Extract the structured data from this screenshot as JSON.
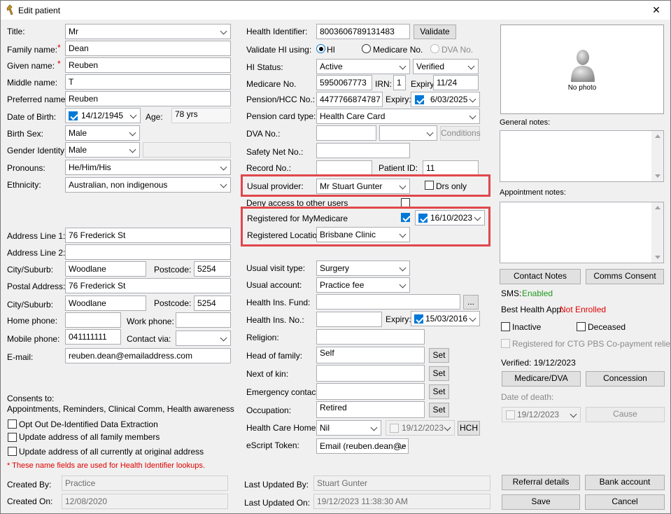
{
  "window": {
    "title": "Edit patient",
    "close_glyph": "✕"
  },
  "left": {
    "title_label": "Title:",
    "title_value": "Mr",
    "family_label": "Family name:",
    "family_value": "Dean",
    "given_label": "Given name:",
    "given_value": "Reuben",
    "middle_label": "Middle name:",
    "middle_value": "T",
    "preferred_label": "Preferred name:",
    "preferred_value": "Reuben",
    "dob_label": "Date of Birth:",
    "dob_value": "14/12/1945",
    "age_label": "Age:",
    "age_value": "78 yrs",
    "sex_label": "Birth Sex:",
    "sex_value": "Male",
    "gender_label": "Gender Identity:",
    "gender_value": "Male",
    "gender_extra": "",
    "pronouns_label": "Pronouns:",
    "pronouns_value": "He/Him/His",
    "ethnicity_label": "Ethnicity:",
    "ethnicity_value": "Australian, non indigenous",
    "addr1_label": "Address Line 1:",
    "addr1_value": "76 Frederick St",
    "addr2_label": "Address Line 2:",
    "addr2_value": "",
    "city_label": "City/Suburb:",
    "city_value": "Woodlane",
    "postcode_label": "Postcode:",
    "postcode_value": "5254",
    "postal_label": "Postal Address:",
    "postal_value": "76 Frederick St",
    "city2_label": "City/Suburb:",
    "city2_value": "Woodlane",
    "postcode2_label": "Postcode:",
    "postcode2_value": "5254",
    "home_label": "Home phone:",
    "home_value": "",
    "work_label": "Work phone:",
    "work_value": "",
    "mobile_label": "Mobile phone:",
    "mobile_value": "041111111",
    "contactvia_label": "Contact via:",
    "contactvia_value": "",
    "email_label": "E-mail:",
    "email_value": "reuben.dean@emailaddress.com",
    "consents_label": "Consents to:",
    "consents_value": "Appointments, Reminders, Clinical Comm, Health awareness",
    "optout_label": "Opt Out De-Identified Data Extraction",
    "update_family_label": "Update address of all family members",
    "update_current_label": "Update address of all currently at original address",
    "note": "* These name fields are used for Health Identifier lookups.",
    "createdby_label": "Created By:",
    "createdby_value": "Practice",
    "createdon_label": "Created On:",
    "createdon_value": "12/08/2020",
    "required_star": "*"
  },
  "middle": {
    "hi_label": "Health Identifier:",
    "hi_value": "8003606789131483",
    "validate_button": "Validate",
    "validate_using_label": "Validate HI using:",
    "opt_hi": "HI",
    "opt_medicare": "Medicare No.",
    "opt_dva": "DVA No.",
    "hi_status_label": "HI Status:",
    "hi_status_value": "Active",
    "hi_verified_value": "Verified",
    "medicare_label": "Medicare No.",
    "medicare_value": "5950067773",
    "irn_label": "IRN:",
    "irn_value": "1",
    "medicare_expiry_label": "Expiry:",
    "medicare_expiry_value": "11/24",
    "pension_label": "Pension/HCC No.:",
    "pension_value": "4477766874787",
    "pension_expiry_label": "Expiry:",
    "pension_expiry_value": "6/03/2025",
    "pension_type_label": "Pension card type:",
    "pension_type_value": "Health Care Card",
    "dva_label": "DVA No.:",
    "dva_value": "",
    "dva_combo": "",
    "conditions_button": "Conditions",
    "safety_label": "Safety Net No.:",
    "safety_value": "",
    "record_label": "Record No.:",
    "record_value": "",
    "patient_id_label": "Patient ID:",
    "patient_id_value": "11",
    "provider_label": "Usual provider:",
    "provider_value": "Mr Stuart Gunter",
    "drs_only_label": "Drs only",
    "deny_label": "Deny access to other users",
    "mymedicare_label": "Registered for MyMedicare",
    "mymedicare_date": "16/10/2023",
    "reg_location_label": "Registered Location:",
    "reg_location_value": "Brisbane Clinic",
    "visit_type_label": "Usual visit type:",
    "visit_type_value": "Surgery",
    "account_label": "Usual account:",
    "account_value": "Practice fee",
    "fund_label": "Health Ins. Fund:",
    "fund_value": "",
    "fund_button": "...",
    "ins_no_label": "Health Ins. No.:",
    "ins_no_value": "",
    "ins_expiry_label": "Expiry:",
    "ins_expiry_value": "15/03/2016",
    "religion_label": "Religion:",
    "religion_value": "",
    "head_label": "Head of family:",
    "head_value": "Self",
    "kin_label": "Next of kin:",
    "kin_value": "",
    "emergency_label": "Emergency contact:",
    "emergency_value": "",
    "occupation_label": "Occupation:",
    "occupation_value": "Retired",
    "set_button": "Set",
    "hch_label": "Health Care Home:",
    "hch_value": "Nil",
    "hch_date": "19/12/2023",
    "hch_button": "HCH",
    "escript_label": "eScript Token:",
    "escript_value": "Email (reuben.dean@e",
    "lastby_label": "Last Updated By:",
    "lastby_value": "Stuart Gunter",
    "laston_label": "Last Updated On:",
    "laston_value": "19/12/2023 11:38:30 AM"
  },
  "right": {
    "photo_caption": "No photo",
    "general_notes_label": "General notes:",
    "appointment_notes_label": "Appointment notes:",
    "contact_notes_button": "Contact Notes",
    "comms_consent_button": "Comms Consent",
    "sms_label": "SMS:",
    "sms_value": "Enabled",
    "bha_label": "Best Health App:",
    "bha_value": "Not Enrolled",
    "inactive_label": "Inactive",
    "deceased_label": "Deceased",
    "ctg_label": "Registered for CTG PBS Co-payment relief",
    "verified_label": "Verified: 19/12/2023",
    "medicare_dva_button": "Medicare/DVA",
    "concession_button": "Concession",
    "death_label": "Date of death:",
    "death_value": "19/12/2023",
    "cause_button": "Cause",
    "referral_button": "Referral details",
    "bank_button": "Bank account",
    "save_button": "Save",
    "cancel_button": "Cancel"
  },
  "colors": {
    "highlight_box": "#e0474c",
    "enabled": "#1e9a1e",
    "not_enrolled": "#e00000",
    "required": "#d00000",
    "checkbox_on": "#0078d7"
  }
}
